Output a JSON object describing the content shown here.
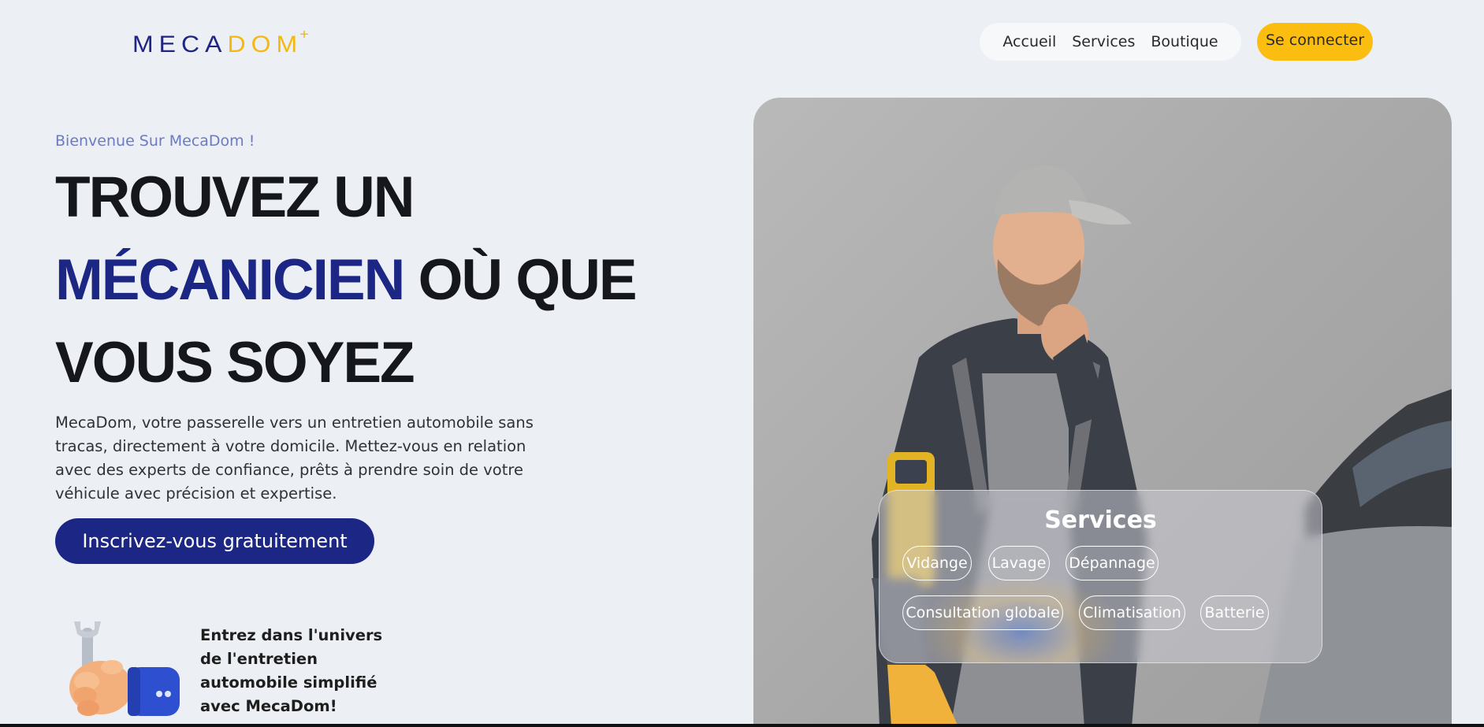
{
  "header": {
    "logo": {
      "part1": "MECA",
      "part2": "D",
      "part3": "OM",
      "mark": "+"
    },
    "nav": [
      "Accueil",
      "Services",
      "Boutique"
    ],
    "login_label": "Se connecter"
  },
  "hero": {
    "welcome": "Bienvenue Sur MecaDom !",
    "title_line1": "TROUVEZ UN",
    "title_highlight": "MÉCANICIEN",
    "title_line2_rest": " OÙ QUE",
    "title_line3": "VOUS SOYEZ",
    "description": "MecaDom, votre passerelle vers un entretien automobile sans tracas, directement à votre domicile. Mettez-vous en relation avec des experts de confiance, prêts à prendre soin de votre véhicule avec précision et expertise.",
    "cta_label": "Inscrivez-vous gratuitement",
    "univers_text": "Entrez dans l'univers de l'entretien automobile simplifié avec MecaDom!"
  },
  "services_card": {
    "title": "Services",
    "chips": [
      "Vidange",
      "Lavage",
      "Dépannage",
      "Consultation globale",
      "Climatisation",
      "Batterie"
    ]
  },
  "colors": {
    "brand_blue": "#1c2685",
    "accent_yellow": "#fbbd10",
    "background": "#eceff3"
  },
  "icons": {
    "wrench_hand": "wrench-hand-icon"
  }
}
